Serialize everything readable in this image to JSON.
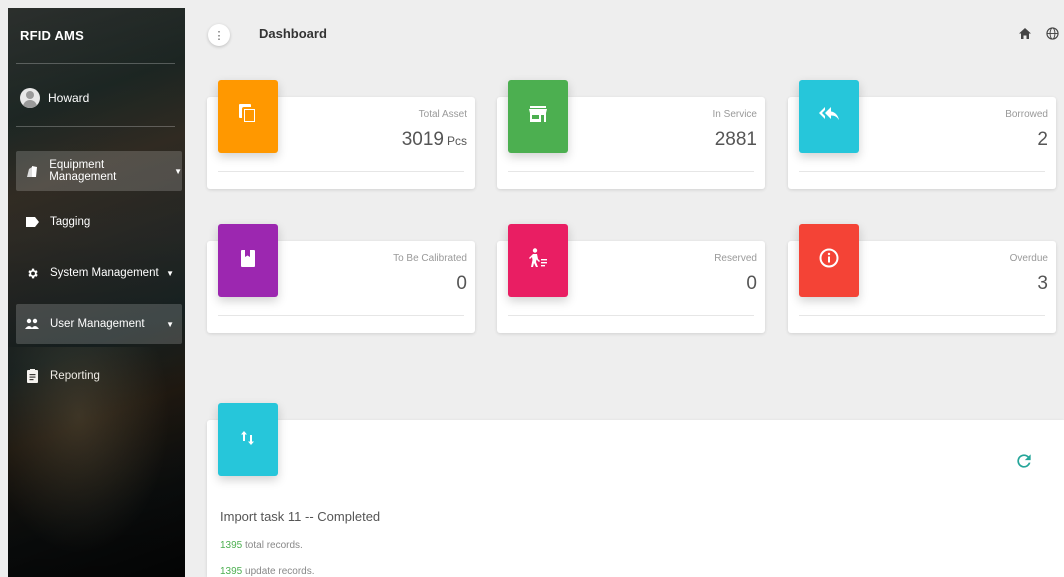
{
  "app": {
    "title": "RFID AMS"
  },
  "user": {
    "name": "Howard"
  },
  "sidebar": {
    "items": [
      {
        "label": "Equipment Management",
        "icon": "equipment-icon",
        "has_caret": true
      },
      {
        "label": "Tagging",
        "icon": "tag-icon",
        "has_caret": false
      },
      {
        "label": "System Management",
        "icon": "gear-icon",
        "has_caret": true
      },
      {
        "label": "User Management",
        "icon": "users-icon",
        "has_caret": true
      },
      {
        "label": "Reporting",
        "icon": "clipboard-icon",
        "has_caret": false
      }
    ]
  },
  "header": {
    "title": "Dashboard",
    "icons": [
      "home-icon",
      "globe-icon"
    ]
  },
  "cards": [
    {
      "label": "Total Asset",
      "value": "3019",
      "unit": "Pcs",
      "color": "#ff9800",
      "icon": "copy-icon"
    },
    {
      "label": "In Service",
      "value": "2881",
      "unit": "",
      "color": "#4caf50",
      "icon": "store-icon"
    },
    {
      "label": "Borrowed",
      "value": "2",
      "unit": "",
      "color": "#26c6da",
      "icon": "reply-all-icon"
    },
    {
      "label": "To Be Calibrated",
      "value": "0",
      "unit": "",
      "color": "#9c27b0",
      "icon": "bookmark-book-icon"
    },
    {
      "label": "Reserved",
      "value": "0",
      "unit": "",
      "color": "#e91e63",
      "icon": "person-queue-icon"
    },
    {
      "label": "Overdue",
      "value": "3",
      "unit": "",
      "color": "#f44336",
      "icon": "info-icon"
    }
  ],
  "import_panel": {
    "icon": "import-export-icon",
    "title": "Import task 11 -- Completed",
    "total_records_num": "1395",
    "total_records_text": "total records.",
    "update_records_num": "1395",
    "update_records_text": "update records."
  }
}
